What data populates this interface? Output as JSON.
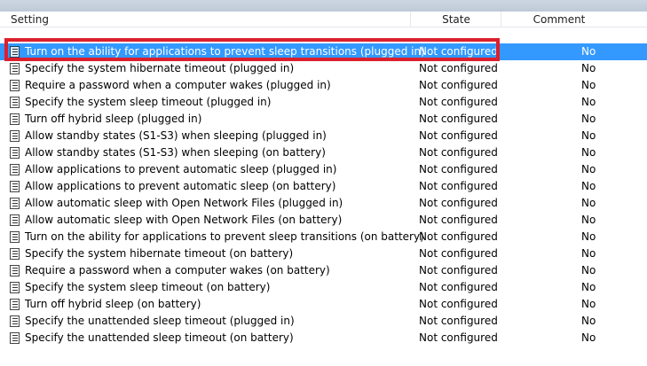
{
  "columns": {
    "setting": "Setting",
    "state": "State",
    "comment": "Comment"
  },
  "colors": {
    "selection": "#3399ff",
    "highlight": "#dc1f2d"
  },
  "icon": "policy-document-icon",
  "rows": [
    {
      "name": "Turn on the ability for applications to prevent sleep transitions (plugged in)",
      "state": "Not configured",
      "comment": "No"
    },
    {
      "name": "Specify the system hibernate timeout (plugged in)",
      "state": "Not configured",
      "comment": "No"
    },
    {
      "name": "Require a password when a computer wakes (plugged in)",
      "state": "Not configured",
      "comment": "No"
    },
    {
      "name": "Specify the system sleep timeout (plugged in)",
      "state": "Not configured",
      "comment": "No"
    },
    {
      "name": "Turn off hybrid sleep (plugged in)",
      "state": "Not configured",
      "comment": "No"
    },
    {
      "name": "Allow standby states (S1-S3) when sleeping (plugged in)",
      "state": "Not configured",
      "comment": "No"
    },
    {
      "name": "Allow standby states (S1-S3) when sleeping (on battery)",
      "state": "Not configured",
      "comment": "No"
    },
    {
      "name": "Allow applications to prevent automatic sleep (plugged in)",
      "state": "Not configured",
      "comment": "No"
    },
    {
      "name": "Allow applications to prevent automatic sleep (on battery)",
      "state": "Not configured",
      "comment": "No"
    },
    {
      "name": "Allow automatic sleep with Open Network Files (plugged in)",
      "state": "Not configured",
      "comment": "No"
    },
    {
      "name": "Allow automatic sleep with Open Network Files (on battery)",
      "state": "Not configured",
      "comment": "No"
    },
    {
      "name": "Turn on the ability for applications to prevent sleep transitions (on battery)",
      "state": "Not configured",
      "comment": "No"
    },
    {
      "name": "Specify the system hibernate timeout (on battery)",
      "state": "Not configured",
      "comment": "No"
    },
    {
      "name": "Require a password when a computer wakes (on battery)",
      "state": "Not configured",
      "comment": "No"
    },
    {
      "name": "Specify the system sleep timeout (on battery)",
      "state": "Not configured",
      "comment": "No"
    },
    {
      "name": "Turn off hybrid sleep (on battery)",
      "state": "Not configured",
      "comment": "No"
    },
    {
      "name": "Specify the unattended sleep timeout (plugged in)",
      "state": "Not configured",
      "comment": "No"
    },
    {
      "name": "Specify the unattended sleep timeout (on battery)",
      "state": "Not configured",
      "comment": "No"
    }
  ]
}
